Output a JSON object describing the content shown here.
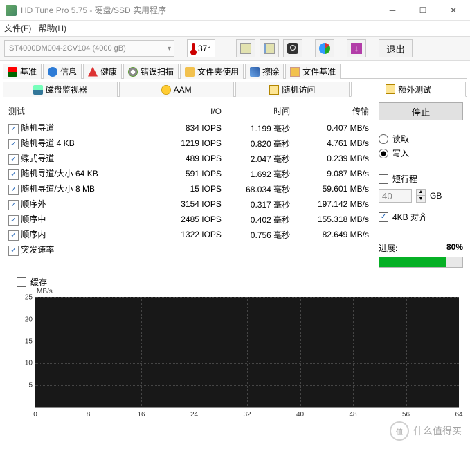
{
  "window": {
    "title": "HD Tune Pro 5.75 - 硬盘/SSD 实用程序"
  },
  "menu": {
    "file": "文件(F)",
    "help": "帮助(H)"
  },
  "toolbar": {
    "drive": "ST4000DM004-2CV104 (4000 gB)",
    "temp": "37°",
    "exit": "退出"
  },
  "tabs": {
    "benchmark": "基准",
    "info": "信息",
    "health": "健康",
    "errorscan": "错误扫描",
    "folderusage": "文件夹使用",
    "erase": "擦除",
    "filebench": "文件基准",
    "diskmonitor": "磁盘监视器",
    "aam": "AAM",
    "randomaccess": "随机访问",
    "extra": "额外测试"
  },
  "table": {
    "headers": {
      "test": "测试",
      "io": "I/O",
      "time": "时间",
      "transfer": "传输"
    },
    "rows": [
      {
        "name": "随机寻道",
        "io": "834 IOPS",
        "time": "1.199 毫秒",
        "tr": "0.407 MB/s"
      },
      {
        "name": "随机寻道 4 KB",
        "io": "1219 IOPS",
        "time": "0.820 毫秒",
        "tr": "4.761 MB/s"
      },
      {
        "name": "蝶式寻道",
        "io": "489 IOPS",
        "time": "2.047 毫秒",
        "tr": "0.239 MB/s"
      },
      {
        "name": "随机寻道/大小 64 KB",
        "io": "591 IOPS",
        "time": "1.692 毫秒",
        "tr": "9.087 MB/s"
      },
      {
        "name": "随机寻道/大小 8 MB",
        "io": "15 IOPS",
        "time": "68.034 毫秒",
        "tr": "59.601 MB/s"
      },
      {
        "name": "顺序外",
        "io": "3154 IOPS",
        "time": "0.317 毫秒",
        "tr": "197.142 MB/s"
      },
      {
        "name": "顺序中",
        "io": "2485 IOPS",
        "time": "0.402 毫秒",
        "tr": "155.318 MB/s"
      },
      {
        "name": "顺序内",
        "io": "1322 IOPS",
        "time": "0.756 毫秒",
        "tr": "82.649 MB/s"
      },
      {
        "name": "突发速率",
        "io": "",
        "time": "",
        "tr": ""
      }
    ]
  },
  "side": {
    "stop": "停止",
    "read": "读取",
    "write": "写入",
    "short": "短行程",
    "shortval": "40",
    "gb": "GB",
    "align": "4KB 对齐",
    "progress_label": "进展:",
    "progress_value": "80%",
    "progress_pct": 80
  },
  "cache": "缓存",
  "chart_data": {
    "type": "line",
    "title": "",
    "xlabel": "",
    "ylabel": "MB/s",
    "xlim": [
      0,
      64
    ],
    "ylim": [
      0,
      25
    ],
    "xticks": [
      0,
      8,
      16,
      24,
      32,
      40,
      48,
      56,
      64
    ],
    "yticks": [
      5,
      10,
      15,
      20,
      25
    ],
    "series": [
      {
        "name": "burst",
        "values": []
      }
    ]
  },
  "watermark": {
    "brand": "什么值得买",
    "badge": "值"
  }
}
